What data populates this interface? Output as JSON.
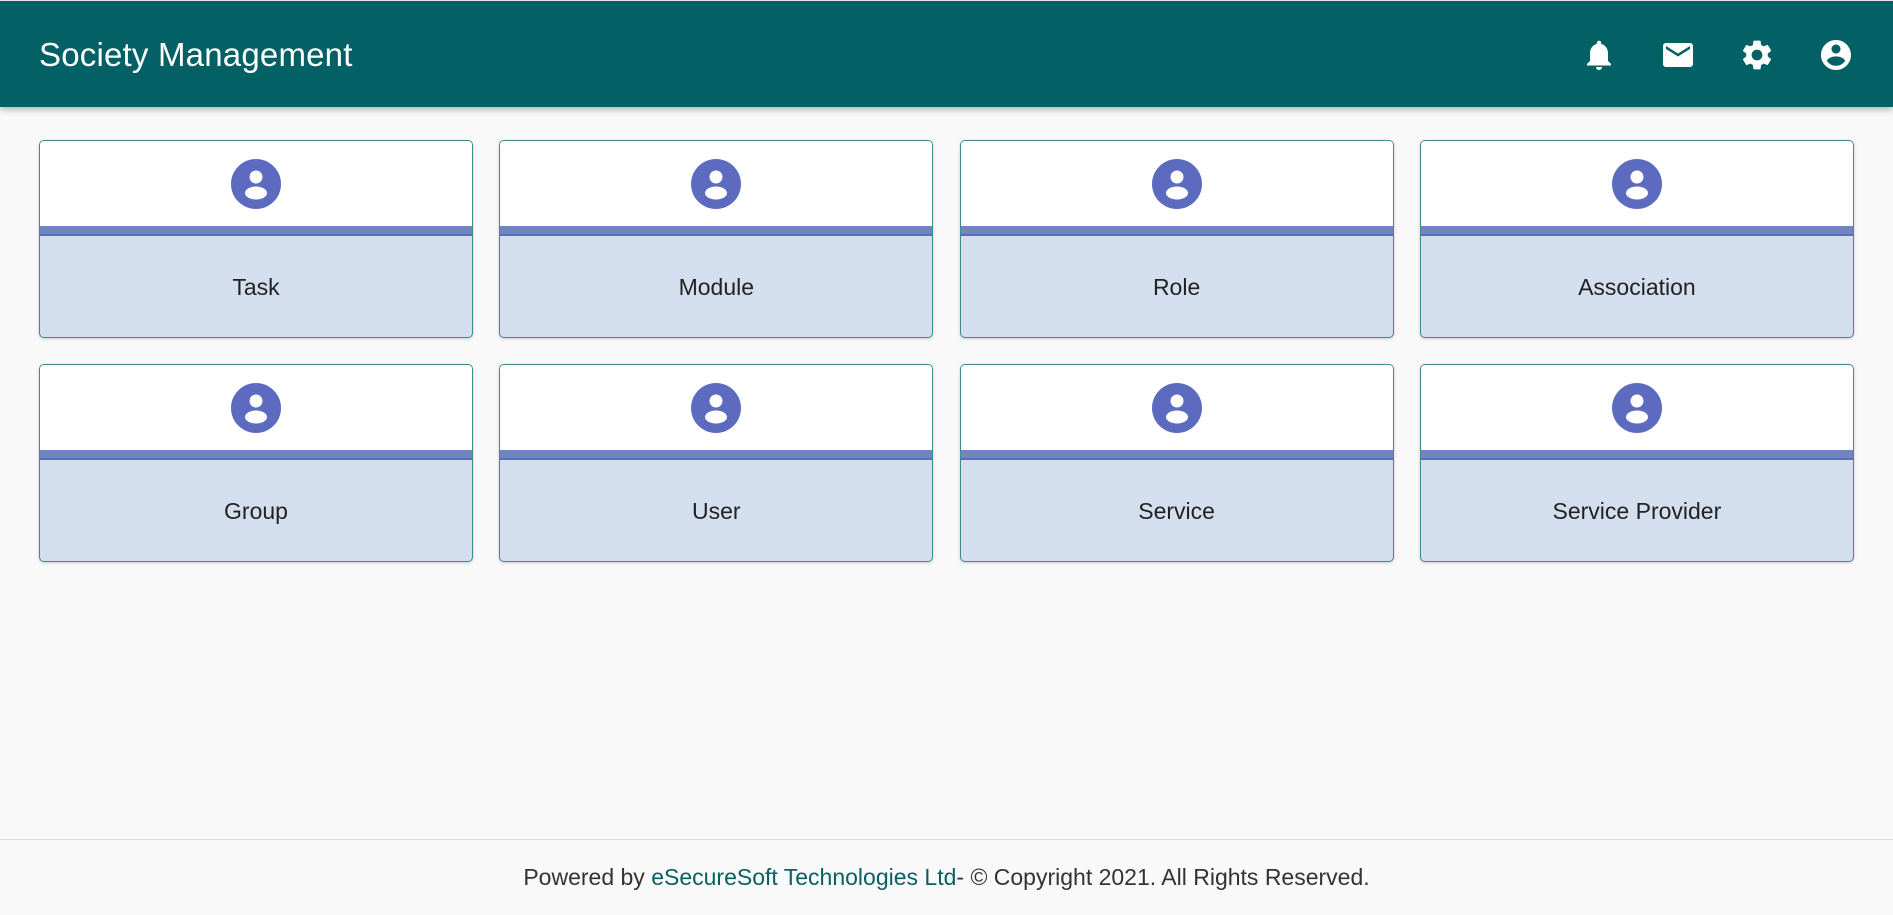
{
  "header": {
    "title": "Society Management",
    "icons": [
      "bell-icon",
      "mail-icon",
      "gear-icon",
      "account-circle-icon"
    ]
  },
  "tiles": [
    {
      "label": "Task",
      "icon": "account-circle-icon"
    },
    {
      "label": "Module",
      "icon": "account-circle-icon"
    },
    {
      "label": "Role",
      "icon": "account-circle-icon"
    },
    {
      "label": "Association",
      "icon": "account-circle-icon"
    },
    {
      "label": "Group",
      "icon": "account-circle-icon"
    },
    {
      "label": "User",
      "icon": "account-circle-icon"
    },
    {
      "label": "Service",
      "icon": "account-circle-icon"
    },
    {
      "label": "Service Provider",
      "icon": "account-circle-icon"
    }
  ],
  "footer": {
    "prefix": "Powered by ",
    "company": "eSecureSoft Technologies Ltd",
    "suffix": "- © Copyright 2021. All Rights Reserved."
  },
  "colors": {
    "header_bg": "#036064",
    "tile_icon": "#5c6bc0",
    "tile_bar": "#7084c6",
    "tile_body": "#d3dfee",
    "link": "#0a5f63"
  }
}
